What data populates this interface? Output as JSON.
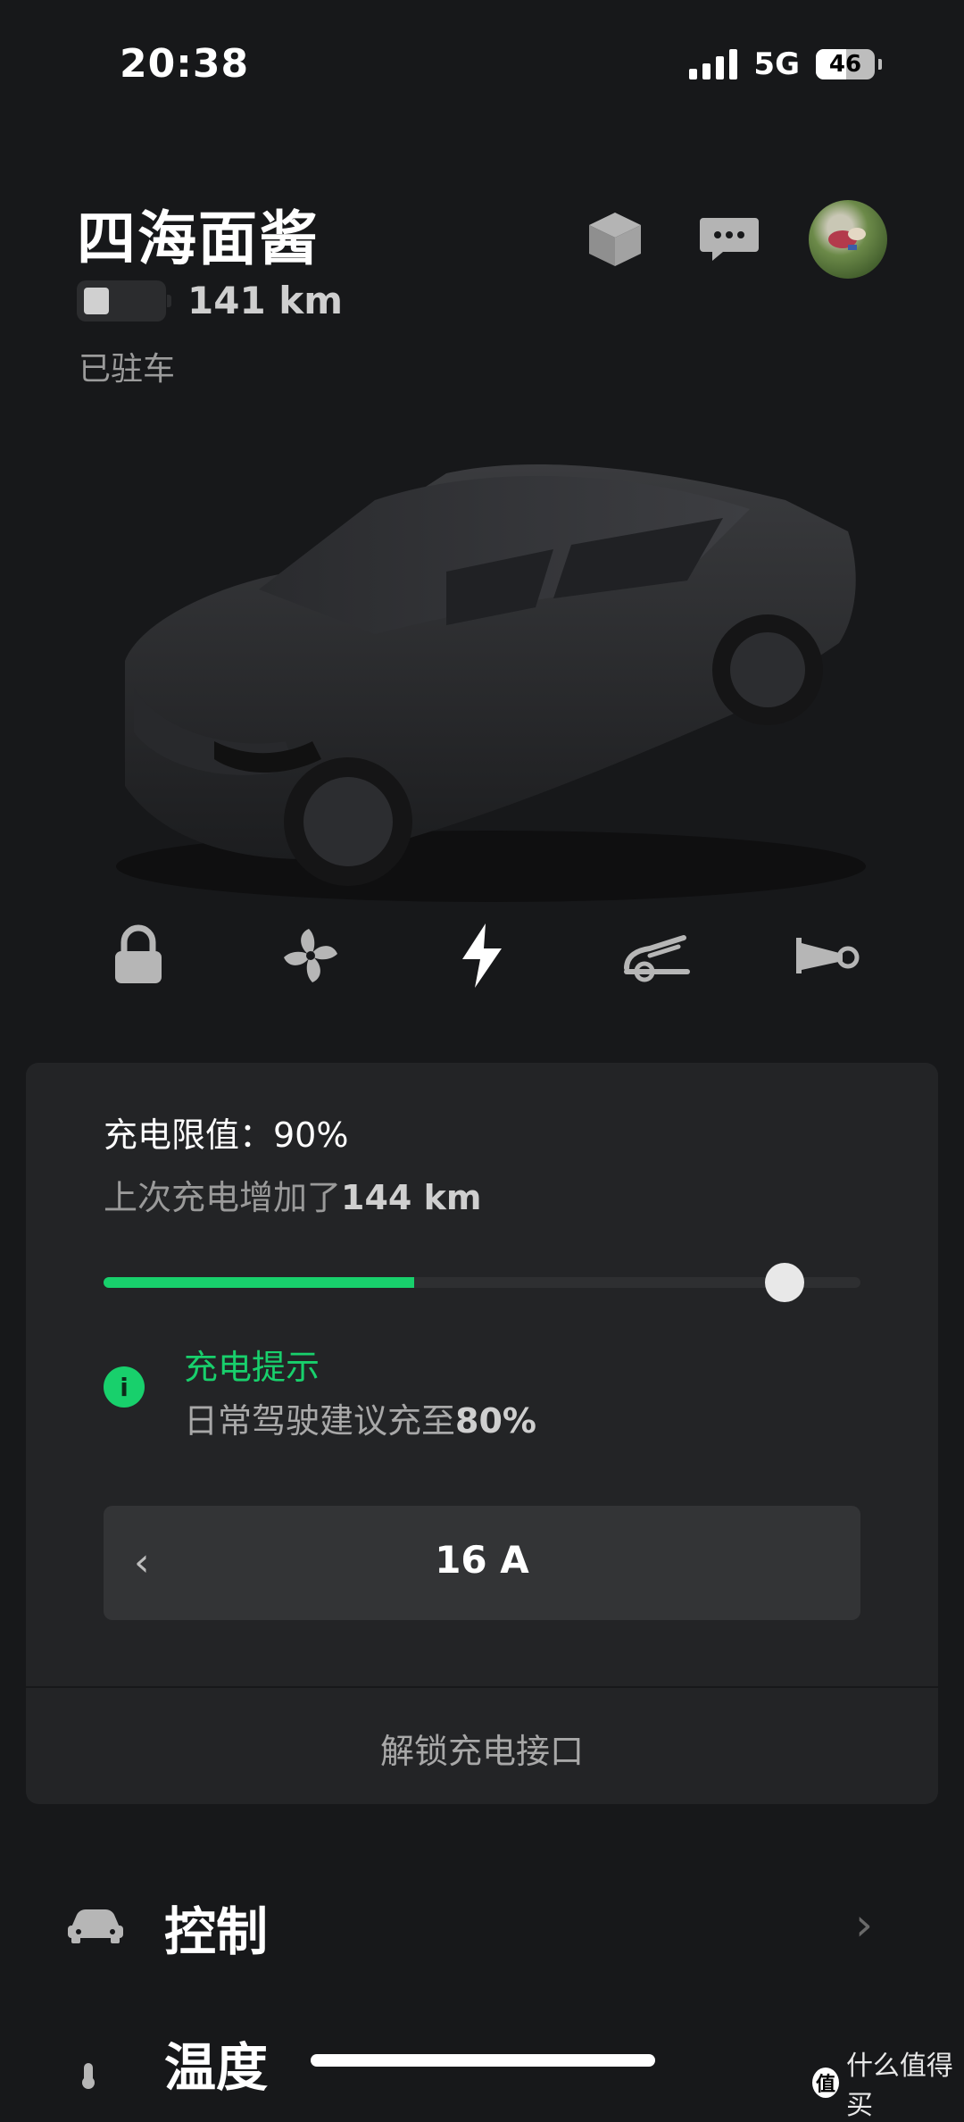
{
  "status_bar": {
    "time": "20:38",
    "network": "5G",
    "battery_level": "46"
  },
  "header": {
    "car_name": "四海面酱",
    "range": "141 km",
    "status": "已驻车",
    "icons": [
      "cube-icon",
      "message-icon",
      "avatar"
    ]
  },
  "actions": [
    "lock-icon",
    "fan-icon",
    "charge-bolt-icon",
    "frunk-icon",
    "horn-icon"
  ],
  "charging": {
    "limit_label": "充电限值：90%",
    "added_prefix": "上次充电增加了",
    "added_value": "144 km",
    "current_level_fraction": 0.41,
    "limit_fraction": 0.9,
    "tip_title": "充电提示",
    "tip_body_prefix": "日常驾驶建议充至",
    "tip_body_value": "80%",
    "tip_icon": "i",
    "amps": "16 A",
    "chevron": "‹",
    "unlock_port": "解锁充电接口",
    "accent_color": "#18d06c"
  },
  "list": {
    "controls_label": "控制",
    "temperature_label": "温度",
    "chevron": "›"
  },
  "watermark": {
    "logo": "值",
    "text": "什么值得买"
  }
}
